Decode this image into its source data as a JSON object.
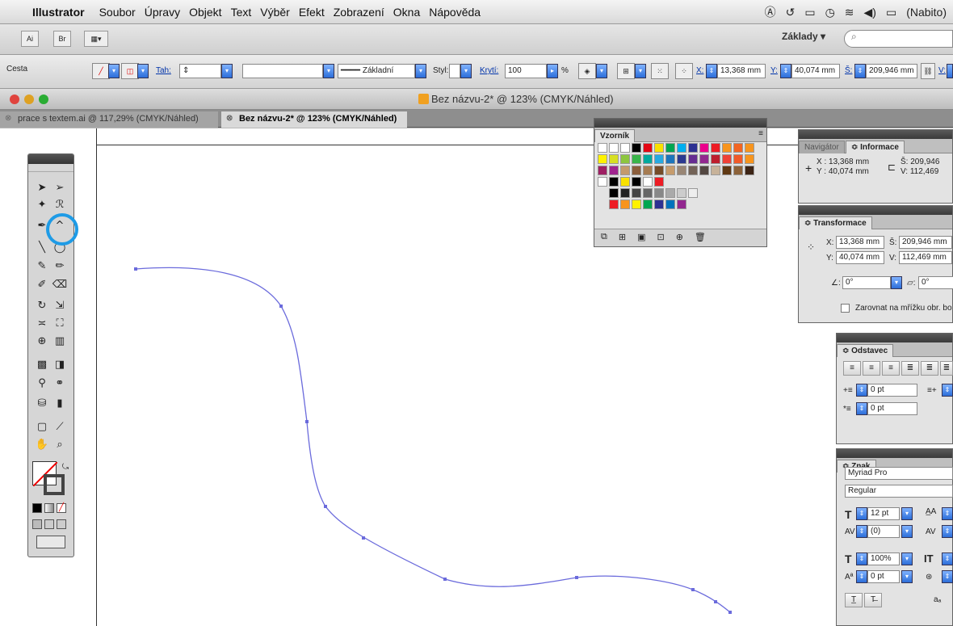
{
  "menubar": {
    "app_name": "Illustrator",
    "items": [
      "Soubor",
      "Úpravy",
      "Objekt",
      "Text",
      "Výběr",
      "Efekt",
      "Zobrazení",
      "Okna",
      "Nápověda"
    ],
    "battery_label": "(Nabito)"
  },
  "app_toolbar": {
    "br_label": "Br",
    "workspace_label": "Základy ▾",
    "search_placeholder": ""
  },
  "control_bar": {
    "object_label": "Cesta",
    "stroke_link": "Tah:",
    "stroke_profile": "Základní",
    "style_label": "Styl:",
    "opacity_link": "Krytí:",
    "opacity_value": "100",
    "opacity_unit": "%",
    "x_label": "X:",
    "x_value": "13,368 mm",
    "y_label": "Y:",
    "y_value": "40,074 mm",
    "w_label": "Š:",
    "w_value": "209,946 mm",
    "h_label": "V:"
  },
  "document": {
    "window_title": "Bez názvu-2* @ 123% (CMYK/Náhled)",
    "tabs": [
      {
        "label": "prace s textem.ai @ 117,29% (CMYK/Náhled)"
      },
      {
        "label": "Bez názvu-2* @ 123% (CMYK/Náhled)"
      }
    ]
  },
  "swatches_panel": {
    "title": "Vzorník"
  },
  "info_panel": {
    "tab_navigator": "Navigátor",
    "tab_info": "≎ Informace",
    "x_line": "X : 13,368 mm",
    "y_line": "Y : 40,074 mm",
    "w_line": "Š: 209,946",
    "h_line": "V: 112,469"
  },
  "transform_panel": {
    "title": "≎ Transformace",
    "x_label": "X:",
    "x_value": "13,368 mm",
    "y_label": "Y:",
    "y_value": "40,074 mm",
    "w_label": "Š:",
    "w_value": "209,946 mm",
    "h_label": "V:",
    "h_value": "112,469 mm",
    "angle_value": "0°",
    "shear_value": "0°",
    "align_checkbox_label": "Zarovnat na mřížku obr. bo"
  },
  "paragraph_panel": {
    "title": "≎ Odstavec",
    "left_indent": "0 pt",
    "first_indent": "0 pt"
  },
  "character_panel": {
    "title": "≎ Znak",
    "font_family": "Myriad Pro",
    "font_style": "Regular",
    "font_size": "12 pt",
    "kerning": "(0)",
    "vertical_scale": "100%",
    "baseline_shift": "0 pt"
  },
  "colors": {
    "path_stroke": "#6b6bdc",
    "highlight_ring": "#1e9be6"
  }
}
